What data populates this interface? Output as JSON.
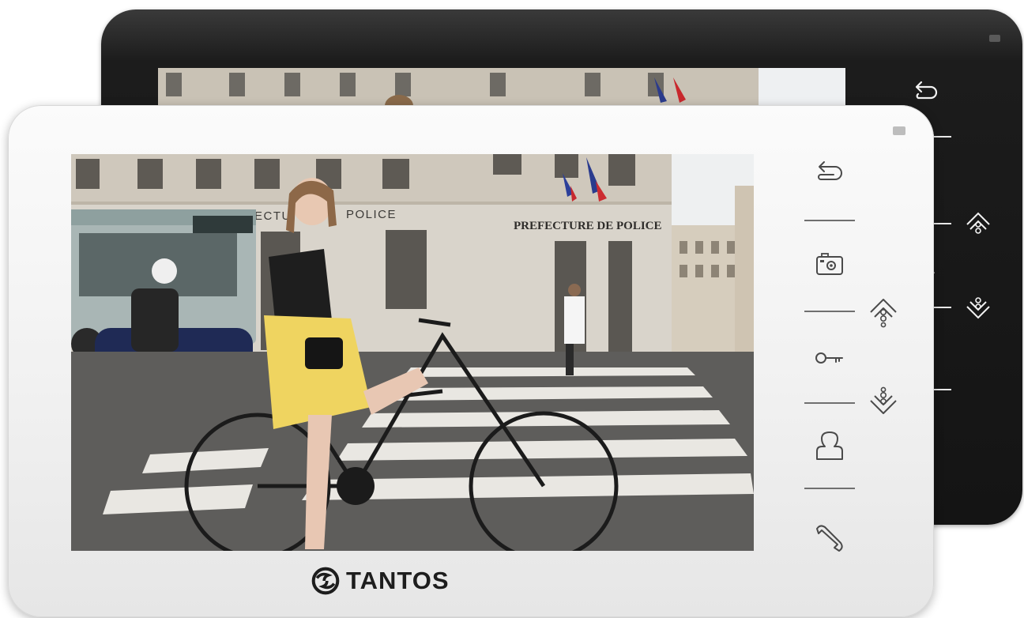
{
  "brand": {
    "name": "TANTOS",
    "logo_icon": "tantos-logo-icon"
  },
  "screen_image": {
    "signs": {
      "prefecture_left": "PREFECTU",
      "police_left": "POLICE",
      "prefecture_right": "PREFECTURE DE POLICE"
    }
  },
  "front_panel_buttons": [
    {
      "name": "back-icon"
    },
    {
      "name": "camera-icon"
    },
    {
      "name": "menu-up-icon"
    },
    {
      "name": "key-icon"
    },
    {
      "name": "menu-down-icon"
    },
    {
      "name": "user-icon"
    },
    {
      "name": "handset-icon"
    }
  ],
  "colors": {
    "white_body": "#f4f4f4",
    "black_body": "#161616",
    "icon_stroke_front": "#4a4a4a",
    "icon_stroke_back": "#f2f2f2"
  }
}
